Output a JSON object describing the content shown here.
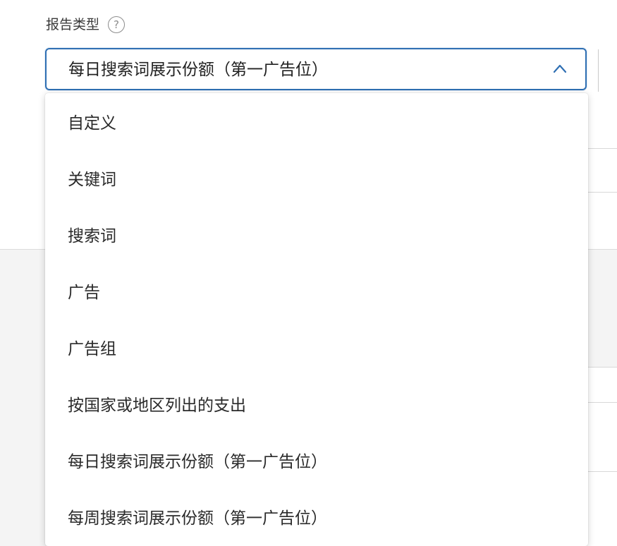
{
  "report_type": {
    "label": "报告类型",
    "help_icon": "?",
    "selected_value": "每日搜索词展示份额（第一广告位）",
    "chevron_icon": "chevron-up-icon"
  },
  "menu": {
    "items": [
      {
        "label": "自定义"
      },
      {
        "label": "关键词"
      },
      {
        "label": "搜索词"
      },
      {
        "label": "广告"
      },
      {
        "label": "广告组"
      },
      {
        "label": "按国家或地区列出的支出"
      },
      {
        "label": "每日搜索词展示份额（第一广告位）"
      },
      {
        "label": "每周搜索词展示份额（第一广告位）"
      }
    ]
  },
  "colors": {
    "accent_border": "#2f6fb3",
    "text": "#2a2a2a",
    "label_text": "#3a3a3a",
    "help_icon": "#8c8c8c"
  }
}
